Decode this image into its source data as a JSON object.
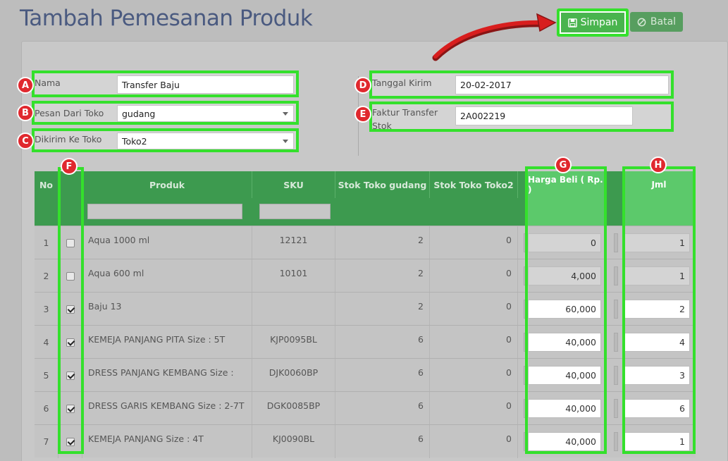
{
  "page": {
    "title": "Tambah Pemesanan Produk"
  },
  "toolbar": {
    "save_label": "Simpan",
    "cancel_label": "Batal"
  },
  "form": {
    "nama": {
      "label": "Nama",
      "value": "Transfer Baju"
    },
    "pesan_dari": {
      "label": "Pesan Dari Toko",
      "value": "gudang"
    },
    "dikirim_ke": {
      "label": "Dikirim Ke Toko",
      "value": "Toko2"
    },
    "tanggal": {
      "label": "Tanggal Kirim",
      "value": "20-02-2017"
    },
    "faktur": {
      "label_1": "Faktur Transfer",
      "label_2": "Stok",
      "value": "2A002219"
    }
  },
  "badges": {
    "a": "A",
    "b": "B",
    "c": "C",
    "d": "D",
    "e": "E",
    "f": "F",
    "g": "G",
    "h": "H"
  },
  "table": {
    "headers": {
      "no": "No",
      "produk": "Produk",
      "sku": "SKU",
      "stok_gudang": "Stok Toko gudang",
      "stok_toko2": "Stok Toko Toko2",
      "harga": "Harga Beli ( Rp. )",
      "jml": "Jml"
    },
    "rows": [
      {
        "no": "1",
        "checked": false,
        "produk": "Aqua 1000 ml",
        "sku": "12121",
        "stok_gudang": "2",
        "stok_toko2": "0",
        "harga": "0",
        "jml": "1"
      },
      {
        "no": "2",
        "checked": false,
        "produk": "Aqua 600 ml",
        "sku": "10101",
        "stok_gudang": "2",
        "stok_toko2": "0",
        "harga": "4,000",
        "jml": "1"
      },
      {
        "no": "3",
        "checked": true,
        "produk": "Baju 13",
        "sku": "",
        "stok_gudang": "2",
        "stok_toko2": "0",
        "harga": "60,000",
        "jml": "2"
      },
      {
        "no": "4",
        "checked": true,
        "produk": "KEMEJA PANJANG PITA Size : 5T",
        "sku": "KJP0095BL",
        "stok_gudang": "6",
        "stok_toko2": "0",
        "harga": "40,000",
        "jml": "4"
      },
      {
        "no": "5",
        "checked": true,
        "produk": "DRESS PANJANG KEMBANG Size :",
        "sku": "DJK0060BP",
        "stok_gudang": "6",
        "stok_toko2": "0",
        "harga": "40,000",
        "jml": "3"
      },
      {
        "no": "6",
        "checked": true,
        "produk": "DRESS GARIS KEMBANG Size : 2-7T",
        "sku": "DGK0085BP",
        "stok_gudang": "6",
        "stok_toko2": "0",
        "harga": "40,000",
        "jml": "6"
      },
      {
        "no": "7",
        "checked": true,
        "produk": "KEMEJA PANJANG Size : 4T",
        "sku": "KJ0090BL",
        "stok_gudang": "6",
        "stok_toko2": "0",
        "harga": "40,000",
        "jml": "1"
      }
    ]
  },
  "colors": {
    "accent_green": "#34e02c",
    "header_green": "#3d9a4f",
    "badge_red": "#e0282e",
    "arrow_red": "#d81e1e"
  }
}
